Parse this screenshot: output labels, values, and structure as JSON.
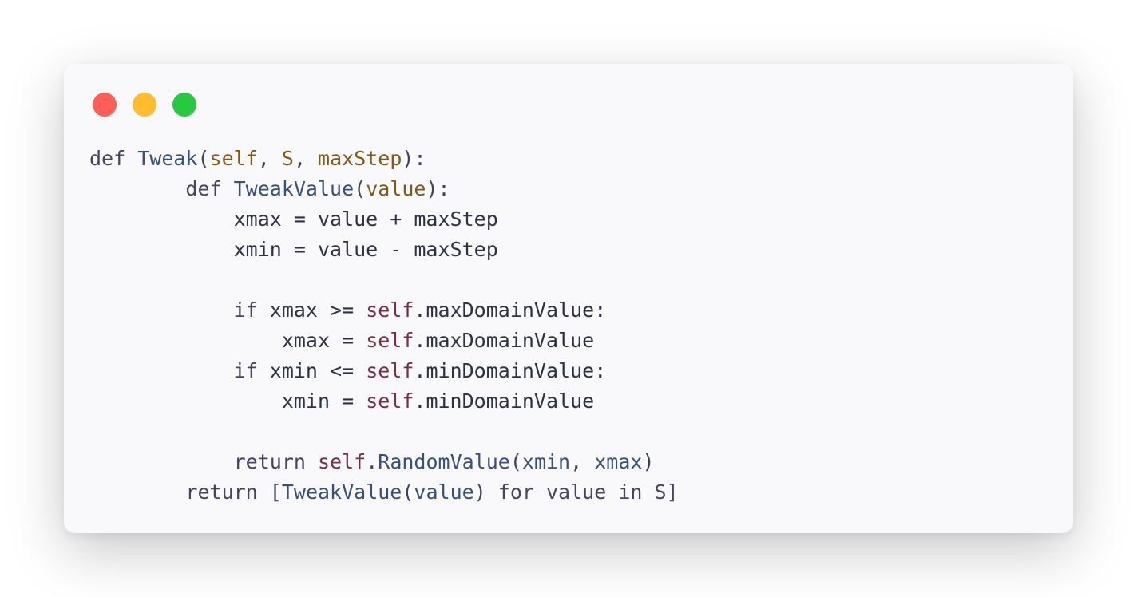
{
  "window": {
    "controls": [
      {
        "name": "close-button",
        "color": "#ff5f57"
      },
      {
        "name": "minimize-button",
        "color": "#febc2e"
      },
      {
        "name": "maximize-button",
        "color": "#28c840"
      }
    ]
  },
  "code": {
    "language": "python",
    "lines": [
      [
        {
          "t": "def ",
          "c": "keyword"
        },
        {
          "t": "Tweak",
          "c": "func"
        },
        {
          "t": "(",
          "c": "punct"
        },
        {
          "t": "self",
          "c": "param"
        },
        {
          "t": ", ",
          "c": "punct"
        },
        {
          "t": "S",
          "c": "param"
        },
        {
          "t": ", ",
          "c": "punct"
        },
        {
          "t": "maxStep",
          "c": "param"
        },
        {
          "t": "):",
          "c": "punct"
        }
      ],
      [
        {
          "t": "        def ",
          "c": "keyword"
        },
        {
          "t": "TweakValue",
          "c": "func"
        },
        {
          "t": "(",
          "c": "punct"
        },
        {
          "t": "value",
          "c": "param"
        },
        {
          "t": "):",
          "c": "punct"
        }
      ],
      [
        {
          "t": "            xmax = value + maxStep",
          "c": "plain"
        }
      ],
      [
        {
          "t": "            xmin = value - maxStep",
          "c": "plain"
        }
      ],
      [],
      [
        {
          "t": "            if ",
          "c": "keyword"
        },
        {
          "t": "xmax >= ",
          "c": "plain"
        },
        {
          "t": "self",
          "c": "self"
        },
        {
          "t": ".maxDomainValue:",
          "c": "plain"
        }
      ],
      [
        {
          "t": "                xmax = ",
          "c": "plain"
        },
        {
          "t": "self",
          "c": "self"
        },
        {
          "t": ".maxDomainValue",
          "c": "plain"
        }
      ],
      [
        {
          "t": "            if ",
          "c": "keyword"
        },
        {
          "t": "xmin <= ",
          "c": "plain"
        },
        {
          "t": "self",
          "c": "self"
        },
        {
          "t": ".minDomainValue:",
          "c": "plain"
        }
      ],
      [
        {
          "t": "                xmin = ",
          "c": "plain"
        },
        {
          "t": "self",
          "c": "self"
        },
        {
          "t": ".minDomainValue",
          "c": "plain"
        }
      ],
      [],
      [
        {
          "t": "            return ",
          "c": "keyword"
        },
        {
          "t": "self",
          "c": "self"
        },
        {
          "t": ".",
          "c": "punct"
        },
        {
          "t": "RandomValue",
          "c": "func"
        },
        {
          "t": "(",
          "c": "punct"
        },
        {
          "t": "xmin",
          "c": "func"
        },
        {
          "t": ", ",
          "c": "punct"
        },
        {
          "t": "xmax",
          "c": "func"
        },
        {
          "t": ")",
          "c": "punct"
        }
      ],
      [
        {
          "t": "        return ",
          "c": "keyword"
        },
        {
          "t": "[",
          "c": "punct"
        },
        {
          "t": "TweakValue",
          "c": "func"
        },
        {
          "t": "(",
          "c": "punct"
        },
        {
          "t": "value",
          "c": "func"
        },
        {
          "t": ") ",
          "c": "punct"
        },
        {
          "t": "for value in S]",
          "c": "keyword"
        }
      ]
    ]
  }
}
